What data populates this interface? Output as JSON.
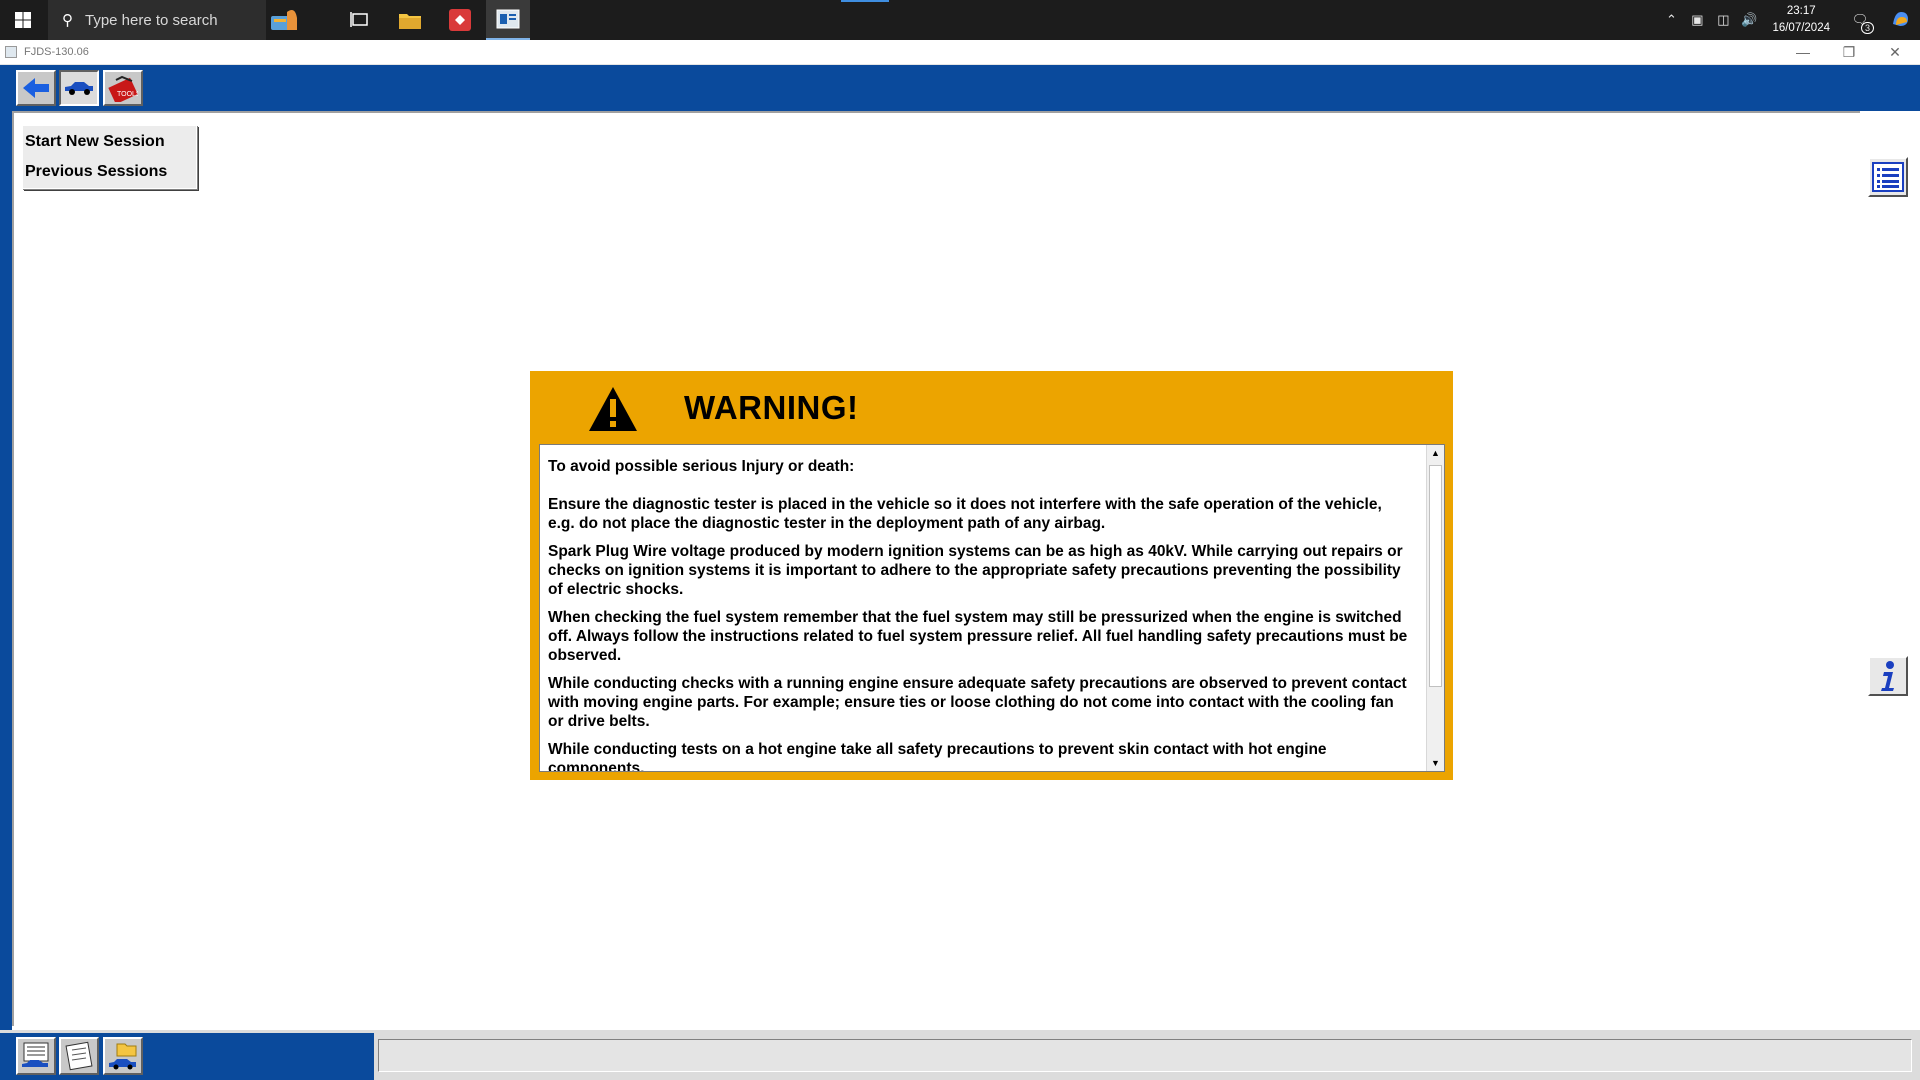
{
  "taskbar": {
    "search_placeholder": "Type here to search",
    "clock_time": "23:17",
    "clock_date": "16/07/2024",
    "notification_count": "3"
  },
  "window": {
    "title": "FJDS-130.06"
  },
  "session_menu": {
    "start_new": "Start New Session",
    "previous": "Previous Sessions"
  },
  "warning": {
    "title": "WARNING!",
    "intro": "To avoid possible serious Injury or death:",
    "paragraphs": [
      "Ensure the diagnostic tester is placed in the vehicle so it does not interfere with the safe operation of the vehicle, e.g. do not place the diagnostic tester in the deployment path of any airbag.",
      "Spark Plug Wire voltage produced by modern ignition systems can be as high as 40kV. While carrying out repairs or checks on ignition systems it is important to adhere to the appropriate safety precautions preventing the possibility of electric shocks.",
      "When checking the fuel system remember that the fuel system may still be pressurized when the engine is switched off. Always follow the instructions related to fuel system pressure relief. All fuel handling safety precautions must be observed.",
      "While conducting checks with a running engine ensure adequate safety precautions are observed to prevent contact with moving engine parts. For example; ensure ties or loose clothing do not come into contact with the cooling fan or drive belts.",
      "While conducting tests on a hot engine take all safety precautions to prevent skin contact with hot engine components."
    ]
  },
  "colors": {
    "header_blue": "#0a4a9c",
    "warning_amber": "#eca400"
  }
}
